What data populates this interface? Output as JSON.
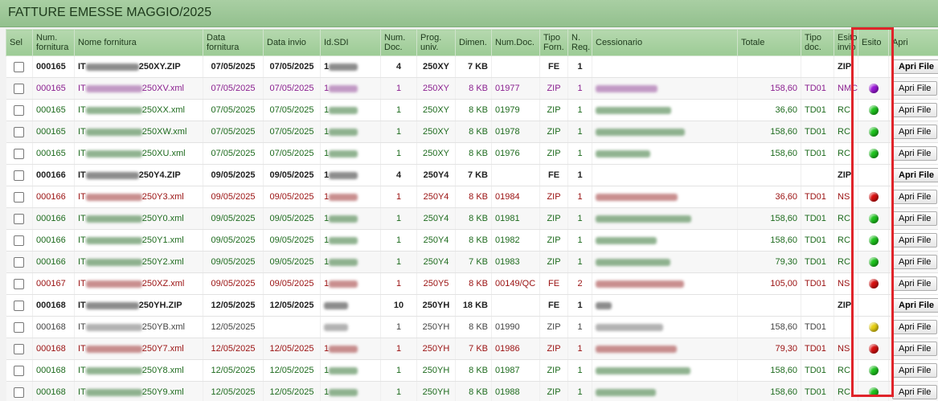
{
  "page_title": "FATTURE EMESSE MAGGIO/2025",
  "columns": [
    "Sel",
    "Num. fornitura",
    "Nome fornitura",
    "Data fornitura",
    "Data invio",
    "Id.SDI",
    "Num. Doc.",
    "Prog. univ.",
    "Dimen.",
    "Num.Doc.",
    "Tipo Forn.",
    "N. Req.",
    "Cessionario",
    "Totale",
    "Tipo doc.",
    "Esito invio",
    "Esito",
    "Apri"
  ],
  "button_label": "Apri File",
  "colors": {
    "green": "#1ec41e",
    "red": "#d80f0f",
    "purple": "#9b18d8",
    "yellow": "#e8d012"
  },
  "rows": [
    {
      "style": "bold",
      "num": "000165",
      "pre": "IT",
      "suf": "250XY.ZIP",
      "dforn": "07/05/2025",
      "dinv": "07/05/2025",
      "sdi": "1",
      "ndoc": "4",
      "prog": "250XY",
      "dim": "7 KB",
      "numdoc": "",
      "tipo": "FE",
      "nreq": "1",
      "totale": "",
      "tdoc": "",
      "esinv": "ZIP",
      "esito": "",
      "btn_bold": true
    },
    {
      "style": "purple",
      "num": "000165",
      "pre": "IT",
      "suf": "250XV.xml",
      "dforn": "07/05/2025",
      "dinv": "07/05/2025",
      "sdi": "1",
      "ndoc": "1",
      "prog": "250XY",
      "dim": "8 KB",
      "numdoc": "01977",
      "tipo": "ZIP",
      "nreq": "1",
      "totale": "158,60",
      "tdoc": "TD01",
      "esinv": "NMC",
      "esito": "purple",
      "btn_bold": false
    },
    {
      "style": "green",
      "num": "000165",
      "pre": "IT",
      "suf": "250XX.xml",
      "dforn": "07/05/2025",
      "dinv": "07/05/2025",
      "sdi": "1",
      "ndoc": "1",
      "prog": "250XY",
      "dim": "8 KB",
      "numdoc": "01979",
      "tipo": "ZIP",
      "nreq": "1",
      "totale": "36,60",
      "tdoc": "TD01",
      "esinv": "RC",
      "esito": "green",
      "btn_bold": false
    },
    {
      "style": "green",
      "num": "000165",
      "pre": "IT",
      "suf": "250XW.xml",
      "dforn": "07/05/2025",
      "dinv": "07/05/2025",
      "sdi": "1",
      "ndoc": "1",
      "prog": "250XY",
      "dim": "8 KB",
      "numdoc": "01978",
      "tipo": "ZIP",
      "nreq": "1",
      "totale": "158,60",
      "tdoc": "TD01",
      "esinv": "RC",
      "esito": "green",
      "btn_bold": false
    },
    {
      "style": "green",
      "num": "000165",
      "pre": "IT",
      "suf": "250XU.xml",
      "dforn": "07/05/2025",
      "dinv": "07/05/2025",
      "sdi": "1",
      "ndoc": "1",
      "prog": "250XY",
      "dim": "8 KB",
      "numdoc": "01976",
      "tipo": "ZIP",
      "nreq": "1",
      "totale": "158,60",
      "tdoc": "TD01",
      "esinv": "RC",
      "esito": "green",
      "btn_bold": false
    },
    {
      "style": "bold",
      "num": "000166",
      "pre": "IT",
      "suf": "250Y4.ZIP",
      "dforn": "09/05/2025",
      "dinv": "09/05/2025",
      "sdi": "1",
      "ndoc": "4",
      "prog": "250Y4",
      "dim": "7 KB",
      "numdoc": "",
      "tipo": "FE",
      "nreq": "1",
      "totale": "",
      "tdoc": "",
      "esinv": "ZIP",
      "esito": "",
      "btn_bold": true
    },
    {
      "style": "red",
      "num": "000166",
      "pre": "IT",
      "suf": "250Y3.xml",
      "dforn": "09/05/2025",
      "dinv": "09/05/2025",
      "sdi": "1",
      "ndoc": "1",
      "prog": "250Y4",
      "dim": "8 KB",
      "numdoc": "01984",
      "tipo": "ZIP",
      "nreq": "1",
      "totale": "36,60",
      "tdoc": "TD01",
      "esinv": "NS",
      "esito": "red",
      "btn_bold": false
    },
    {
      "style": "green",
      "num": "000166",
      "pre": "IT",
      "suf": "250Y0.xml",
      "dforn": "09/05/2025",
      "dinv": "09/05/2025",
      "sdi": "1",
      "ndoc": "1",
      "prog": "250Y4",
      "dim": "8 KB",
      "numdoc": "01981",
      "tipo": "ZIP",
      "nreq": "1",
      "totale": "158,60",
      "tdoc": "TD01",
      "esinv": "RC",
      "esito": "green",
      "btn_bold": false
    },
    {
      "style": "green",
      "num": "000166",
      "pre": "IT",
      "suf": "250Y1.xml",
      "dforn": "09/05/2025",
      "dinv": "09/05/2025",
      "sdi": "1",
      "ndoc": "1",
      "prog": "250Y4",
      "dim": "8 KB",
      "numdoc": "01982",
      "tipo": "ZIP",
      "nreq": "1",
      "totale": "158,60",
      "tdoc": "TD01",
      "esinv": "RC",
      "esito": "green",
      "btn_bold": false
    },
    {
      "style": "green",
      "num": "000166",
      "pre": "IT",
      "suf": "250Y2.xml",
      "dforn": "09/05/2025",
      "dinv": "09/05/2025",
      "sdi": "1",
      "ndoc": "1",
      "prog": "250Y4",
      "dim": "7 KB",
      "numdoc": "01983",
      "tipo": "ZIP",
      "nreq": "1",
      "totale": "79,30",
      "tdoc": "TD01",
      "esinv": "RC",
      "esito": "green",
      "btn_bold": false
    },
    {
      "style": "red",
      "num": "000167",
      "pre": "IT",
      "suf": "250XZ.xml",
      "dforn": "09/05/2025",
      "dinv": "09/05/2025",
      "sdi": "1",
      "ndoc": "1",
      "prog": "250Y5",
      "dim": "8 KB",
      "numdoc": "00149/QC",
      "tipo": "FE",
      "nreq": "2",
      "totale": "105,00",
      "tdoc": "TD01",
      "esinv": "NS",
      "esito": "red",
      "btn_bold": false
    },
    {
      "style": "bold",
      "num": "000168",
      "pre": "IT",
      "suf": "250YH.ZIP",
      "dforn": "12/05/2025",
      "dinv": "12/05/2025",
      "sdi": "",
      "ndoc": "10",
      "prog": "250YH",
      "dim": "18 KB",
      "numdoc": "",
      "tipo": "FE",
      "nreq": "1",
      "totale": "",
      "tdoc": "",
      "esinv": "ZIP",
      "esito": "",
      "btn_bold": true
    },
    {
      "style": "dark",
      "num": "000168",
      "pre": "IT",
      "suf": "250YB.xml",
      "dforn": "12/05/2025",
      "dinv": "",
      "sdi": "",
      "ndoc": "1",
      "prog": "250YH",
      "dim": "8 KB",
      "numdoc": "01990",
      "tipo": "ZIP",
      "nreq": "1",
      "totale": "158,60",
      "tdoc": "TD01",
      "esinv": "",
      "esito": "yellow",
      "btn_bold": false
    },
    {
      "style": "red",
      "num": "000168",
      "pre": "IT",
      "suf": "250Y7.xml",
      "dforn": "12/05/2025",
      "dinv": "12/05/2025",
      "sdi": "1",
      "ndoc": "1",
      "prog": "250YH",
      "dim": "7 KB",
      "numdoc": "01986",
      "tipo": "ZIP",
      "nreq": "1",
      "totale": "79,30",
      "tdoc": "TD01",
      "esinv": "NS",
      "esito": "red",
      "btn_bold": false
    },
    {
      "style": "green",
      "num": "000168",
      "pre": "IT",
      "suf": "250Y8.xml",
      "dforn": "12/05/2025",
      "dinv": "12/05/2025",
      "sdi": "1",
      "ndoc": "1",
      "prog": "250YH",
      "dim": "8 KB",
      "numdoc": "01987",
      "tipo": "ZIP",
      "nreq": "1",
      "totale": "158,60",
      "tdoc": "TD01",
      "esinv": "RC",
      "esito": "green",
      "btn_bold": false
    },
    {
      "style": "green",
      "num": "000168",
      "pre": "IT",
      "suf": "250Y9.xml",
      "dforn": "12/05/2025",
      "dinv": "12/05/2025",
      "sdi": "1",
      "ndoc": "1",
      "prog": "250YH",
      "dim": "8 KB",
      "numdoc": "01988",
      "tipo": "ZIP",
      "nreq": "1",
      "totale": "158,60",
      "tdoc": "TD01",
      "esinv": "RC",
      "esito": "green",
      "btn_bold": false
    }
  ]
}
